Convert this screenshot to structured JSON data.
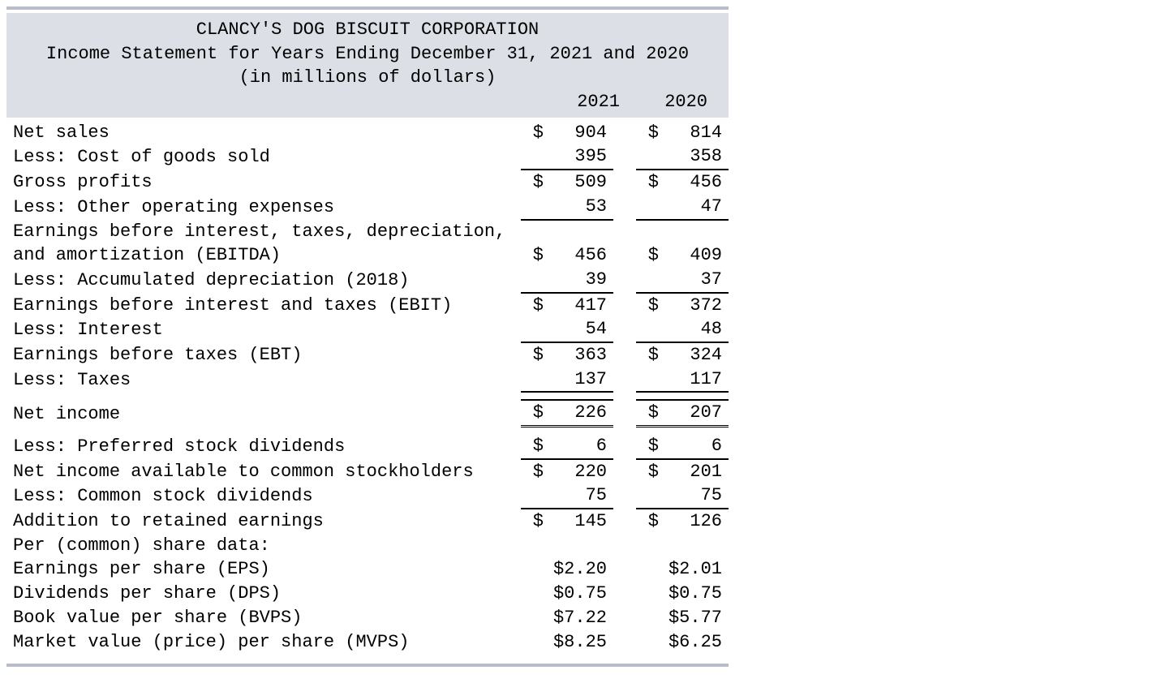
{
  "header": {
    "line1": "CLANCY'S DOG BISCUIT CORPORATION",
    "line2": "Income Statement for Years Ending December 31, 2021 and 2020",
    "line3": "(in millions of dollars)",
    "year_a": "2021",
    "year_b": "2020"
  },
  "rows": {
    "net_sales": {
      "label": "Net sales",
      "a_sym": "$",
      "a_val": "904",
      "b_sym": "$",
      "b_val": "814"
    },
    "cogs": {
      "label": "Less: Cost of goods sold",
      "a_sym": "",
      "a_val": "395",
      "b_sym": "",
      "b_val": "358"
    },
    "gross": {
      "label": "Gross profits",
      "a_sym": "$",
      "a_val": "509",
      "b_sym": "$",
      "b_val": "456"
    },
    "opex": {
      "label": "Less: Other operating expenses",
      "a_sym": "",
      "a_val": "53",
      "b_sym": "",
      "b_val": "47"
    },
    "ebitda_l1": {
      "label": "Earnings before interest, taxes, depreciation,"
    },
    "ebitda_l2": {
      "label": "and amortization (EBITDA)",
      "a_sym": "$",
      "a_val": "456",
      "b_sym": "$",
      "b_val": "409"
    },
    "dep": {
      "label": "Less: Accumulated depreciation (2018)",
      "a_sym": "",
      "a_val": "39",
      "b_sym": "",
      "b_val": "37"
    },
    "ebit": {
      "label": "Earnings before interest and taxes (EBIT)",
      "a_sym": "$",
      "a_val": "417",
      "b_sym": "$",
      "b_val": "372"
    },
    "interest": {
      "label": "Less: Interest",
      "a_sym": "",
      "a_val": "54",
      "b_sym": "",
      "b_val": "48"
    },
    "ebt": {
      "label": "Earnings before taxes (EBT)",
      "a_sym": "$",
      "a_val": "363",
      "b_sym": "$",
      "b_val": "324"
    },
    "taxes": {
      "label": "Less: Taxes",
      "a_sym": "",
      "a_val": "137",
      "b_sym": "",
      "b_val": "117"
    },
    "netinc": {
      "label": "Net income",
      "a_sym": "$",
      "a_val": "226",
      "b_sym": "$",
      "b_val": "207"
    },
    "prefdiv": {
      "label": "Less: Preferred stock dividends",
      "a_sym": "$",
      "a_val": "6",
      "b_sym": "$",
      "b_val": "6"
    },
    "niac": {
      "label": "Net income available to common stockholders",
      "a_sym": "$",
      "a_val": "220",
      "b_sym": "$",
      "b_val": "201"
    },
    "commdiv": {
      "label": "Less: Common stock dividends",
      "a_sym": "",
      "a_val": "75",
      "b_sym": "",
      "b_val": "75"
    },
    "are": {
      "label": "Addition to retained earnings",
      "a_sym": "$",
      "a_val": "145",
      "b_sym": "$",
      "b_val": "126"
    },
    "pshdr": {
      "label": "Per (common) share data:"
    },
    "eps": {
      "label": "Earnings per share (EPS)",
      "a": "$2.20",
      "b": "$2.01"
    },
    "dps": {
      "label": "Dividends per share (DPS)",
      "a": "$0.75",
      "b": "$0.75"
    },
    "bvps": {
      "label": "Book value per share (BVPS)",
      "a": "$7.22",
      "b": "$5.77"
    },
    "mvps": {
      "label": "Market value (price) per share (MVPS)",
      "a": "$8.25",
      "b": "$6.25"
    }
  }
}
